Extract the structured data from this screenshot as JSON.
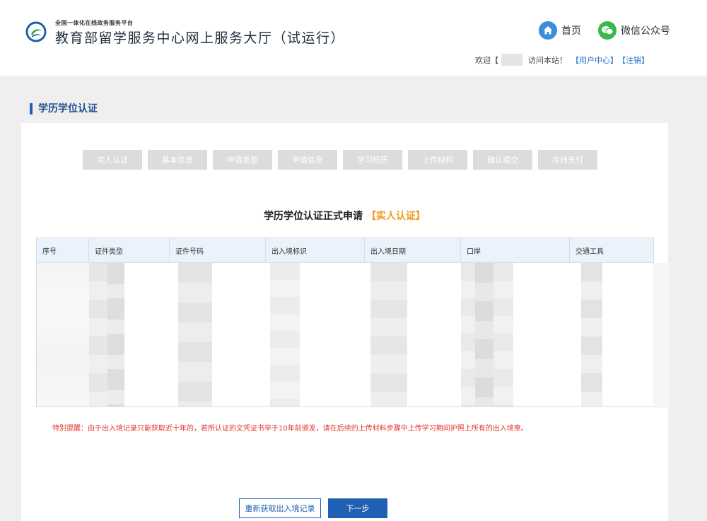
{
  "header": {
    "platform_name": "全国一体化在线政务服务平台",
    "site_title": "教育部留学服务中心网上服务大厅（试运行）",
    "home_label": "首页",
    "wechat_label": "微信公众号",
    "welcome_prefix": "欢迎【",
    "welcome_suffix": "访问本站！",
    "user_center_label": "【用户中心】",
    "logout_label": "【注销】"
  },
  "section": {
    "title": "学历学位认证"
  },
  "steps": [
    "实人认证",
    "基本信息",
    "申请类型",
    "申请信息",
    "学习经历",
    "上传材料",
    "确认提交",
    "在线支付"
  ],
  "form": {
    "title": "学历学位认证正式申请",
    "title_accent": "【实人认证】"
  },
  "table": {
    "columns": [
      "序号",
      "证件类型",
      "证件号码",
      "出入境标识",
      "出入境日期",
      "口岸",
      "交通工具"
    ]
  },
  "notice": "特别提醒：由于出入境记录只能获取近十年的，若所认证的文凭证书早于10年前颁发，请在后续的上传材料步骤中上传学习期间护照上所有的出入境章。",
  "buttons": {
    "refresh": "重新获取出入境记录",
    "next": "下一步"
  },
  "colors": {
    "primary": "#1f5fb4",
    "accent": "#f29a1e",
    "warning": "#e0352b",
    "step_disabled": "#dcdcdc",
    "table_header_bg": "#eaf3fb"
  }
}
